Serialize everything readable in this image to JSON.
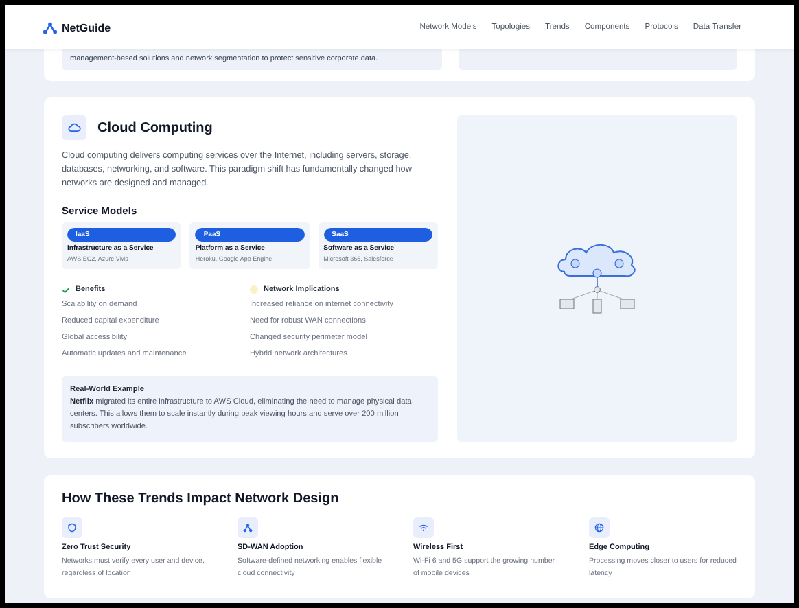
{
  "nav": {
    "brand": "NetGuide",
    "links": [
      "Network Models",
      "Topologies",
      "Trends",
      "Components",
      "Protocols",
      "Data Transfer"
    ]
  },
  "top_card": {
    "text": "management-based solutions and network segmentation to protect sensitive corporate data."
  },
  "cloud": {
    "title": "Cloud Computing",
    "description": "Cloud computing delivers computing services over the Internet, including servers, storage, databases, networking, and software. This paradigm shift has fundamentally changed how networks are designed and managed.",
    "service_models_title": "Service Models",
    "models": [
      {
        "badge": "IaaS",
        "title": "Infrastructure as a Service",
        "examples": "AWS EC2, Azure VMs"
      },
      {
        "badge": "PaaS",
        "title": "Platform as a Service",
        "examples": "Heroku, Google App Engine"
      },
      {
        "badge": "SaaS",
        "title": "Software as a Service",
        "examples": "Microsoft 365, Salesforce"
      }
    ],
    "benefits": {
      "title": "Benefits",
      "items": [
        "Scalability on demand",
        "Reduced capital expenditure",
        "Global accessibility",
        "Automatic updates and maintenance"
      ]
    },
    "implications": {
      "title": "Network Implications",
      "items": [
        "Increased reliance on internet connectivity",
        "Need for robust WAN connections",
        "Changed security perimeter model",
        "Hybrid network architectures"
      ]
    },
    "example": {
      "title": "Real-World Example",
      "text": "**Netflix** migrated its entire infrastructure to AWS Cloud, eliminating the need to manage physical data centers. This allows them to scale instantly during peak viewing hours and serve over 200 million subscribers worldwide."
    }
  },
  "impact": {
    "title": "How These Trends Impact Network Design",
    "items": [
      {
        "title": "Zero Trust Security",
        "text": "Networks must verify every user and device, regardless of location"
      },
      {
        "title": "SD-WAN Adoption",
        "text": "Software-defined networking enables flexible cloud connectivity"
      },
      {
        "title": "Wireless First",
        "text": "Wi-Fi 6 and 5G support the growing number of mobile devices"
      },
      {
        "title": "Edge Computing",
        "text": "Processing moves closer to users for reduced latency"
      }
    ]
  }
}
